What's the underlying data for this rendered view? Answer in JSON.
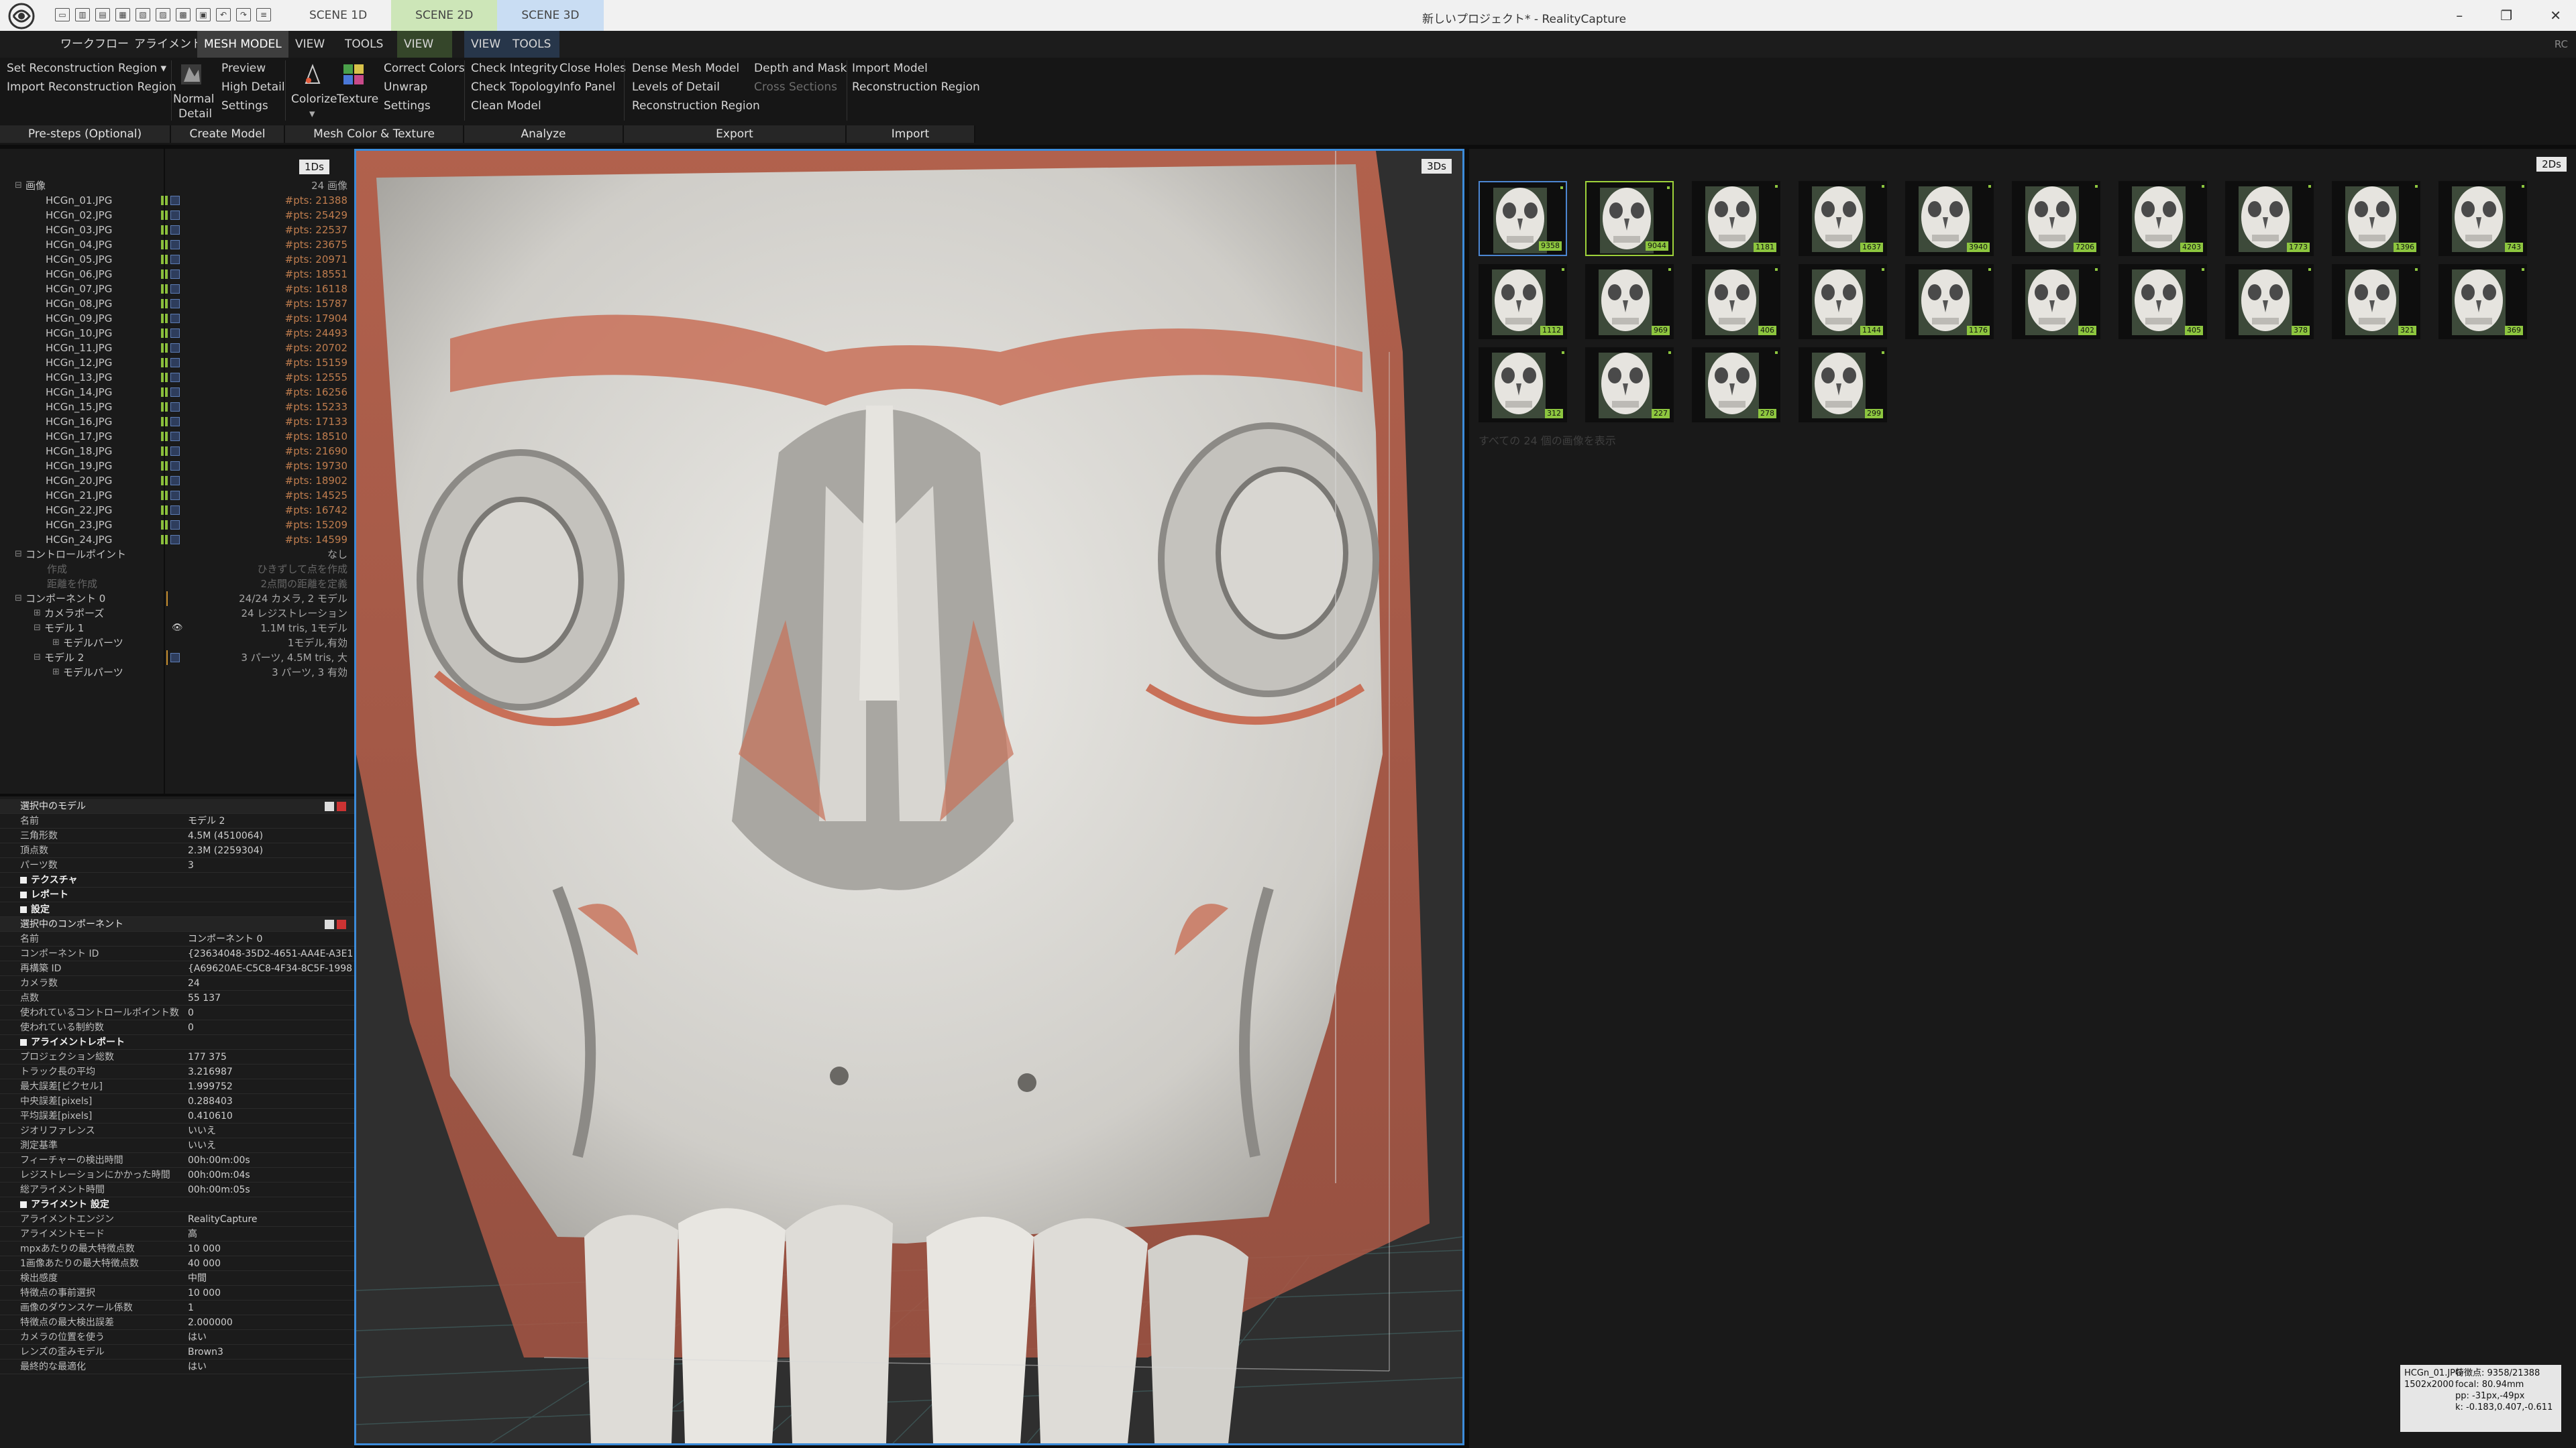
{
  "app": {
    "window_title": "新しいプロジェクト* - RealityCapture",
    "logo": "realitycapture-logo"
  },
  "quick_access": [
    "new",
    "open",
    "save",
    "layout1",
    "layout2",
    "layout3",
    "layout4",
    "layout5",
    "undo",
    "redo",
    "more"
  ],
  "scene_tabs": [
    "SCENE 1D",
    "SCENE 2D",
    "SCENE 3D"
  ],
  "window_controls": [
    "–",
    "❐",
    "✕"
  ],
  "menu": {
    "workflow": "ワークフロー",
    "alignment": "アライメント",
    "mesh_model": "MESH MODEL",
    "view": "VIEW",
    "tools": "TOOLS",
    "view2": "VIEW",
    "tools2": "TOOLS",
    "view3": "VIEW",
    "tools3": "TOOLS",
    "rc": "RC"
  },
  "ribbon": {
    "set_region": "Set Reconstruction Region ▾",
    "import_region": "Import Reconstruction Region",
    "normal": "Normal",
    "detail": "Detail",
    "preview": "Preview",
    "high_detail": "High Detail",
    "settings": "Settings",
    "colorize": "Colorize",
    "texture": "Texture",
    "correct_colors": "Correct Colors",
    "unwrap": "Unwrap",
    "settings2": "Settings",
    "check_integrity": "Check Integrity",
    "check_topology": "Check Topology",
    "clean_model": "Clean Model",
    "close_holes": "Close Holes",
    "info_panel": "Info Panel",
    "dense_mesh": "Dense Mesh Model",
    "lod": "Levels of Detail",
    "recon_region": "Reconstruction Region",
    "depth_mask": "Depth and Mask",
    "cross_sections": "Cross Sections",
    "import_model": "Import Model",
    "import_recon_region": "Reconstruction Region",
    "groups": [
      "Pre-steps (Optional)",
      "Create Model",
      "Mesh Color & Texture",
      "Analyze",
      "Export",
      "Import"
    ]
  },
  "left_tree": {
    "badge": "1Ds",
    "images_label": "画像",
    "images_count": "24 画像",
    "images": [
      {
        "name": "HCGn_01.JPG",
        "pts": "#pts: 21388"
      },
      {
        "name": "HCGn_02.JPG",
        "pts": "#pts: 25429"
      },
      {
        "name": "HCGn_03.JPG",
        "pts": "#pts: 22537"
      },
      {
        "name": "HCGn_04.JPG",
        "pts": "#pts: 23675"
      },
      {
        "name": "HCGn_05.JPG",
        "pts": "#pts: 20971"
      },
      {
        "name": "HCGn_06.JPG",
        "pts": "#pts: 18551"
      },
      {
        "name": "HCGn_07.JPG",
        "pts": "#pts: 16118"
      },
      {
        "name": "HCGn_08.JPG",
        "pts": "#pts: 15787"
      },
      {
        "name": "HCGn_09.JPG",
        "pts": "#pts: 17904"
      },
      {
        "name": "HCGn_10.JPG",
        "pts": "#pts: 24493"
      },
      {
        "name": "HCGn_11.JPG",
        "pts": "#pts: 20702"
      },
      {
        "name": "HCGn_12.JPG",
        "pts": "#pts: 15159"
      },
      {
        "name": "HCGn_13.JPG",
        "pts": "#pts: 12555"
      },
      {
        "name": "HCGn_14.JPG",
        "pts": "#pts: 16256"
      },
      {
        "name": "HCGn_15.JPG",
        "pts": "#pts: 15233"
      },
      {
        "name": "HCGn_16.JPG",
        "pts": "#pts: 17133"
      },
      {
        "name": "HCGn_17.JPG",
        "pts": "#pts: 18510"
      },
      {
        "name": "HCGn_18.JPG",
        "pts": "#pts: 21690"
      },
      {
        "name": "HCGn_19.JPG",
        "pts": "#pts: 19730"
      },
      {
        "name": "HCGn_20.JPG",
        "pts": "#pts: 18902"
      },
      {
        "name": "HCGn_21.JPG",
        "pts": "#pts: 14525"
      },
      {
        "name": "HCGn_22.JPG",
        "pts": "#pts: 16742"
      },
      {
        "name": "HCGn_23.JPG",
        "pts": "#pts: 15209"
      },
      {
        "name": "HCGn_24.JPG",
        "pts": "#pts: 14599"
      }
    ],
    "control_points": "コントロールポイント",
    "cp_value": "なし",
    "cp_create": "作成",
    "cp_create_hint": "ひきずして点を作成",
    "cp_dist": "距離を作成",
    "cp_dist_hint": "2点間の距離を定義",
    "component": "コンポーネント 0",
    "component_val": "24/24 カメラ, 2 モデル",
    "camera_poses": "カメラポーズ",
    "camera_poses_val": "24 レジストレーション",
    "model1": "モデル 1",
    "model1_val": "1.1M tris, 1モデル",
    "model1_parts": "モデルパーツ",
    "model1_parts_val": "1モデル,有効",
    "model2": "モデル 2",
    "model2_val": "3 パーツ, 4.5M tris, 大",
    "model2_parts": "モデルパーツ",
    "model2_parts_val": "3 パーツ, 3 有効"
  },
  "selected_model": {
    "title": "選択中のモデル",
    "rows": [
      [
        "名前",
        "モデル 2"
      ],
      [
        "三角形数",
        "4.5M (4510064)"
      ],
      [
        "頂点数",
        "2.3M (2259304)"
      ],
      [
        "パーツ数",
        "3"
      ]
    ],
    "sections": [
      "テクスチャ",
      "レポート",
      "設定"
    ]
  },
  "selected_component": {
    "title": "選択中のコンポーネント",
    "rows": [
      [
        "名前",
        "コンポーネント 0"
      ],
      [
        "コンポーネント ID",
        "{23634048-35D2-4651-AA4E-A3E1..."
      ],
      [
        "再構築 ID",
        "{A69620AE-C5C8-4F34-8C5F-1998..."
      ],
      [
        "カメラ数",
        "24"
      ],
      [
        "点数",
        "55 137"
      ],
      [
        "使われているコントロールポイント数",
        "0"
      ],
      [
        "使われている制約数",
        "0"
      ]
    ],
    "report_title": "アライメントレポート",
    "report": [
      [
        "プロジェクション総数",
        "177 375"
      ],
      [
        "トラック長の平均",
        "3.216987"
      ],
      [
        "最大誤差[ピクセル]",
        "1.999752"
      ],
      [
        "中央誤差[pixels]",
        "0.288403"
      ],
      [
        "平均誤差[pixels]",
        "0.410610"
      ],
      [
        "ジオリファレンス",
        "いいえ"
      ],
      [
        "測定基準",
        "いいえ"
      ],
      [
        "フィーチャーの検出時間",
        "00h:00m:00s"
      ],
      [
        "レジストレーションにかかった時間",
        "00h:00m:04s"
      ],
      [
        "総アライメント時間",
        "00h:00m:05s"
      ]
    ],
    "settings_title": "アライメント 設定",
    "settings": [
      [
        "アライメントエンジン",
        "RealityCapture"
      ],
      [
        "アライメントモード",
        "高"
      ],
      [
        "mpxあたりの最大特徴点数",
        "10 000"
      ],
      [
        "1画像あたりの最大特徴点数",
        "40 000"
      ],
      [
        "検出感度",
        "中間"
      ],
      [
        "特徴点の事前選択",
        "10 000"
      ],
      [
        "画像のダウンスケール係数",
        "1"
      ],
      [
        "特徴点の最大検出誤差",
        "2.000000"
      ],
      [
        "カメラの位置を使う",
        "はい"
      ],
      [
        "レンズの歪みモデル",
        "Brown3"
      ],
      [
        "最終的な最適化",
        "はい"
      ]
    ]
  },
  "viewport3d": {
    "badge": "3Ds"
  },
  "view2d": {
    "badge": "2Ds",
    "counts": [
      "9358",
      "9044",
      "1181",
      "1637",
      "3940",
      "7206",
      "4203",
      "1773",
      "1396",
      "743",
      "1112",
      "969",
      "406",
      "1144",
      "1176",
      "402",
      "405",
      "378",
      "321",
      "369",
      "312",
      "227",
      "278",
      "299"
    ],
    "footer": "すべての 24 個の画像を表示",
    "info": [
      "HCGn_01.JPG",
      "1502x2000",
      "特徴点: 9358/21388",
      "focal: 80.94mm",
      "pp: -31px,-49px",
      "k: -0.183,0.407,-0.611"
    ]
  },
  "colors": {
    "accent": "#3c8bd9",
    "green": "#8dc63f",
    "pts": "#c07d4e",
    "mesh": "#d9d7d2",
    "mesh_shadow": "#b4b2ae",
    "overlay": "#c87058"
  }
}
